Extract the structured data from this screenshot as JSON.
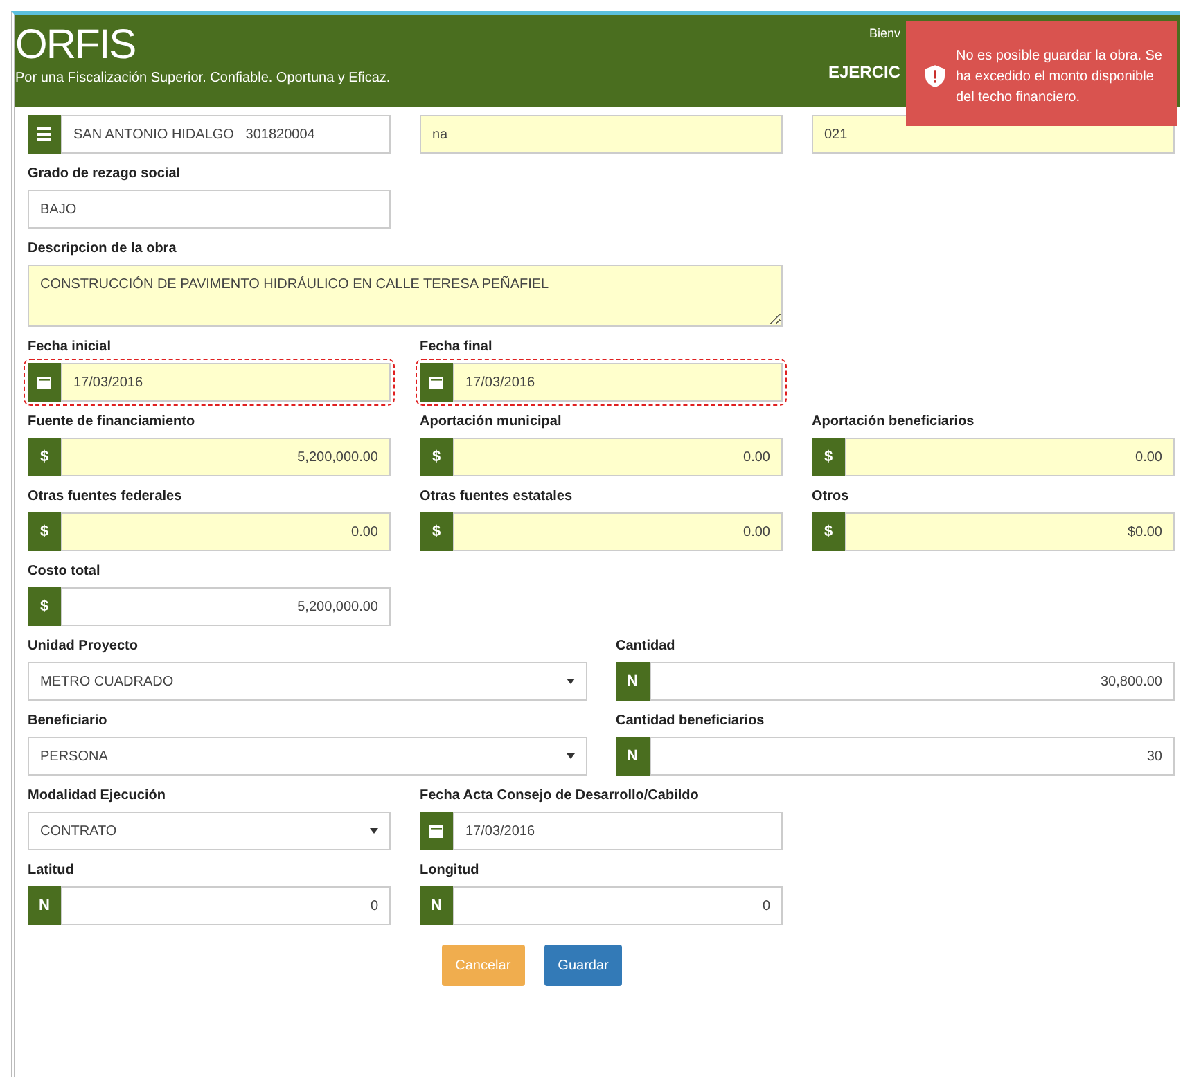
{
  "header": {
    "logo": "ORFIS",
    "tagline": "Por una Fiscalización Superior. Confiable. Oportuna y Eficaz.",
    "welcome": "Bienv",
    "year": "EJERCIC"
  },
  "toast": {
    "message": "No es posible guardar la obra. Se ha excedido el monto disponible del techo financiero."
  },
  "rows": [
    {
      "kind": "thirds",
      "fields": [
        {
          "kind": "text",
          "addon": {
            "kind": "list"
          },
          "value": "SAN ANTONIO HIDALGO   301820004",
          "highlighted": false,
          "error": false
        },
        {
          "kind": "text",
          "value": "na",
          "highlighted": true,
          "error": false
        },
        {
          "kind": "text",
          "value": "021",
          "highlighted": true,
          "error": false
        }
      ]
    },
    {
      "kind": "thirds",
      "fields": [
        {
          "kind": "text",
          "label": "Grado de rezago social",
          "value": "BAJO",
          "highlighted": false,
          "error": false
        }
      ]
    },
    {
      "kind": "thirds",
      "fields": [
        {
          "kind": "textarea",
          "label": "Descripcion de la obra",
          "value": "CONSTRUCCIÓN DE PAVIMENTO HIDRÁULICO EN CALLE TERESA PEÑAFIEL",
          "highlighted": true,
          "error": false
        }
      ]
    },
    {
      "kind": "thirds",
      "fields": [
        {
          "kind": "text",
          "label": "Fecha inicial",
          "addon": {
            "kind": "calendar"
          },
          "value": "17/03/2016",
          "highlighted": true,
          "error": true
        },
        {
          "kind": "text",
          "label": "Fecha final",
          "addon": {
            "kind": "calendar"
          },
          "value": "17/03/2016",
          "highlighted": true,
          "error": true
        }
      ]
    },
    {
      "kind": "thirds",
      "fields": [
        {
          "kind": "number",
          "label": "Fuente de financiamiento",
          "prefix": "$",
          "value": "5,200,000.00",
          "highlighted": true,
          "error": false
        },
        {
          "kind": "number",
          "label": "Aportación municipal",
          "prefix": "$",
          "value": "0.00",
          "highlighted": true,
          "error": false
        },
        {
          "kind": "number",
          "label": "Aportación beneficiarios",
          "prefix": "$",
          "value": "0.00",
          "highlighted": true,
          "error": false
        }
      ]
    },
    {
      "kind": "thirds",
      "fields": [
        {
          "kind": "number",
          "label": "Otras fuentes federales",
          "prefix": "$",
          "value": "0.00",
          "highlighted": true,
          "error": false
        },
        {
          "kind": "number",
          "label": "Otras fuentes estatales",
          "prefix": "$",
          "value": "0.00",
          "highlighted": true,
          "error": false
        },
        {
          "kind": "number",
          "label": "Otros",
          "prefix": "$",
          "value": "$0.00",
          "highlighted": true,
          "error": false
        }
      ]
    },
    {
      "kind": "thirds",
      "fields": [
        {
          "kind": "number",
          "label": "Costo total",
          "prefix": "$",
          "value": "5,200,000.00",
          "highlighted": false,
          "error": false
        }
      ]
    },
    {
      "kind": "halves",
      "fields": [
        {
          "kind": "select",
          "label": "Unidad Proyecto",
          "value": "METRO CUADRADO",
          "highlighted": false,
          "error": false
        },
        {
          "kind": "number",
          "label": "Cantidad",
          "prefix": "N",
          "value": "30,800.00",
          "highlighted": false,
          "error": false
        }
      ]
    },
    {
      "kind": "halves",
      "fields": [
        {
          "kind": "select",
          "label": "Beneficiario",
          "value": "PERSONA",
          "highlighted": false,
          "error": false
        },
        {
          "kind": "number",
          "label": "Cantidad beneficiarios",
          "prefix": "N",
          "value": "30",
          "highlighted": false,
          "error": false
        }
      ]
    },
    {
      "kind": "thirds",
      "fields": [
        {
          "kind": "select",
          "label": "Modalidad Ejecución",
          "value": "CONTRATO",
          "highlighted": false,
          "error": false
        },
        {
          "kind": "text",
          "label": "Fecha Acta Consejo de Desarrollo/Cabildo",
          "addon": {
            "kind": "calendar"
          },
          "value": "17/03/2016",
          "highlighted": false,
          "error": false
        }
      ]
    },
    {
      "kind": "thirds",
      "fields": [
        {
          "kind": "number",
          "label": "Latitud",
          "prefix": "N",
          "value": "0",
          "highlighted": false,
          "error": false
        },
        {
          "kind": "number",
          "label": "Longitud",
          "prefix": "N",
          "value": "0",
          "highlighted": false,
          "error": false
        }
      ]
    }
  ],
  "buttons": [
    {
      "kind": "warning",
      "label": "Cancelar"
    },
    {
      "kind": "primary",
      "label": "Guardar"
    }
  ]
}
